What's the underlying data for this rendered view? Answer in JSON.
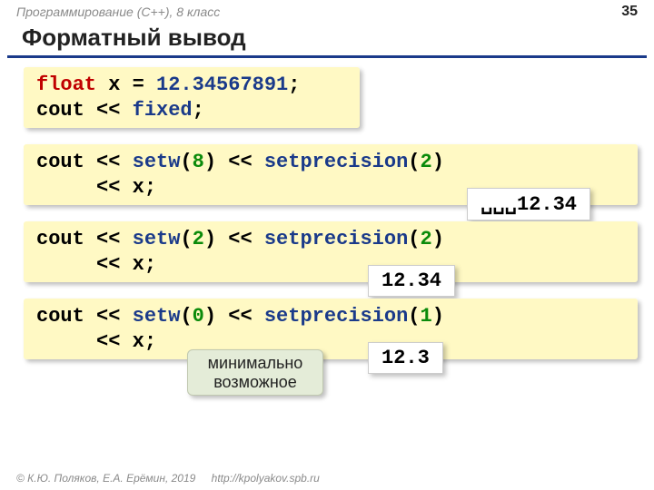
{
  "header": {
    "course": "Программирование (С++), 8 класс",
    "page": "35"
  },
  "title": "Форматный вывод",
  "code1": {
    "t1": "float",
    "t2": " x = ",
    "t3": "12.34567891",
    "t4": ";",
    "t5": "cout << ",
    "t6": "fixed",
    "t7": ";"
  },
  "sec1": {
    "c1": "cout << ",
    "c2": "setw",
    "c3": "(",
    "c4": "8",
    "c5": ") << ",
    "c6": "setprecision",
    "c7": "(",
    "c8": "2",
    "c9": ")",
    "c10": "     << x;",
    "out": "␣␣␣12.34"
  },
  "sec2": {
    "c1": "cout << ",
    "c2": "setw",
    "c3": "(",
    "c4": "2",
    "c5": ") << ",
    "c6": "setprecision",
    "c7": "(",
    "c8": "2",
    "c9": ")",
    "c10": "     << x;",
    "out": "12.34"
  },
  "sec3": {
    "c1": "cout << ",
    "c2": "setw",
    "c3": "(",
    "c4": "0",
    "c5": ") << ",
    "c6": "setprecision",
    "c7": "(",
    "c8": "1",
    "c9": ")",
    "c10": "     << x;",
    "out": "12.3",
    "note": "минимально\nвозможное"
  },
  "footer": {
    "copyright": "© К.Ю. Поляков, Е.А. Ерёмин, 2019",
    "link": "http://kpolyakov.spb.ru"
  }
}
